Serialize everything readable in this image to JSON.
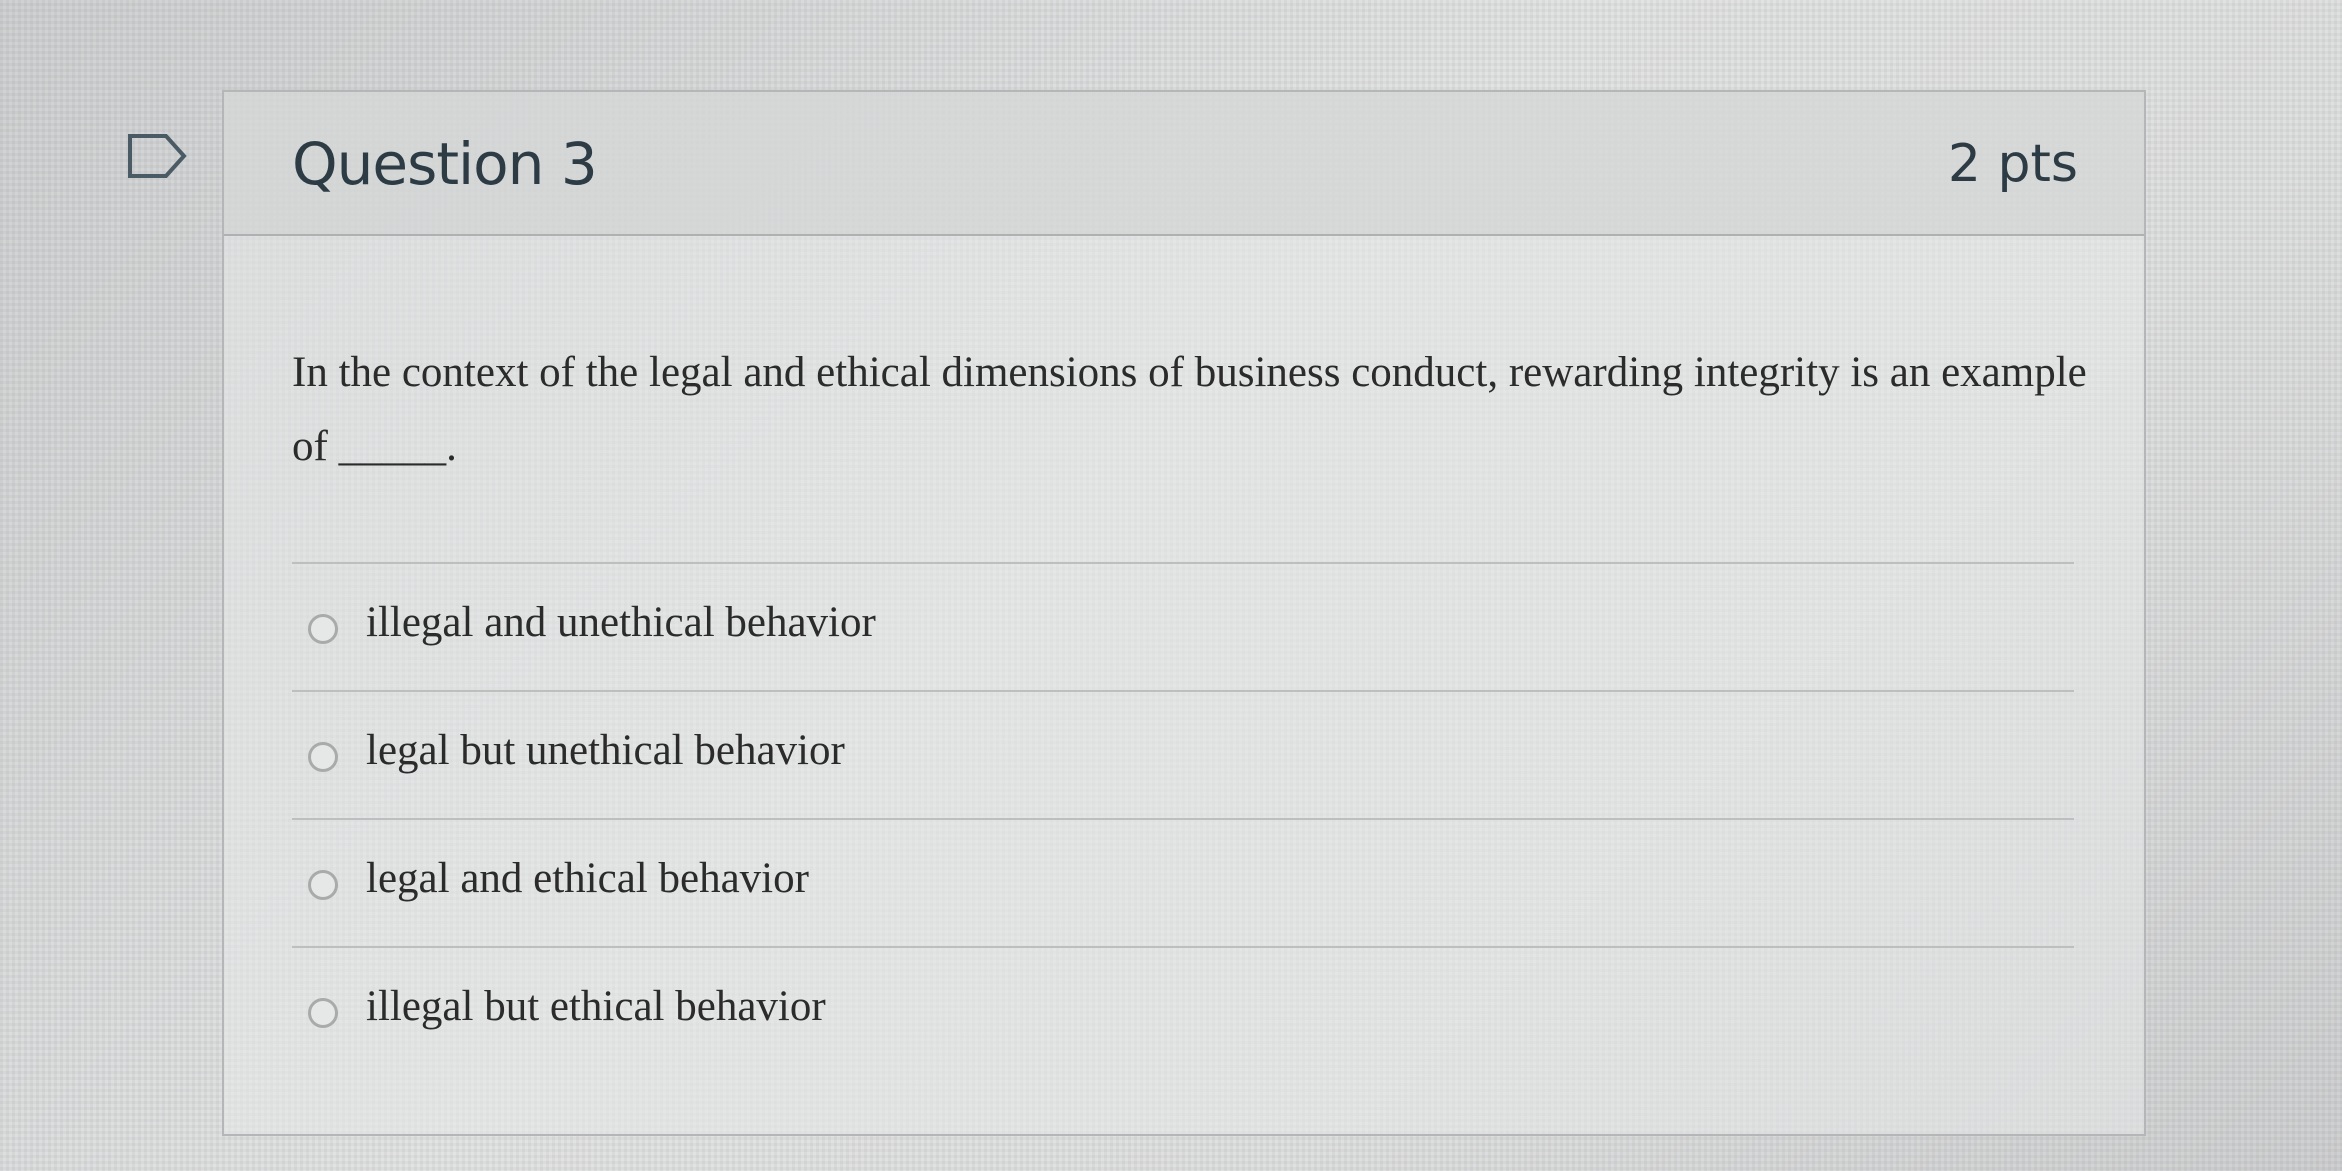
{
  "question": {
    "title": "Question 3",
    "points": "2 pts",
    "text": "In the context of the legal and ethical dimensions of business conduct, rewarding integrity is an example of _____.",
    "flag_icon": "flag-icon"
  },
  "answers": [
    {
      "label": "illegal and unethical behavior"
    },
    {
      "label": "legal but unethical behavior"
    },
    {
      "label": "legal and ethical behavior"
    },
    {
      "label": "illegal but ethical behavior"
    }
  ],
  "colors": {
    "title": "#2d3b45",
    "body_text": "#2b2b2b",
    "border": "#b4b6b7"
  }
}
